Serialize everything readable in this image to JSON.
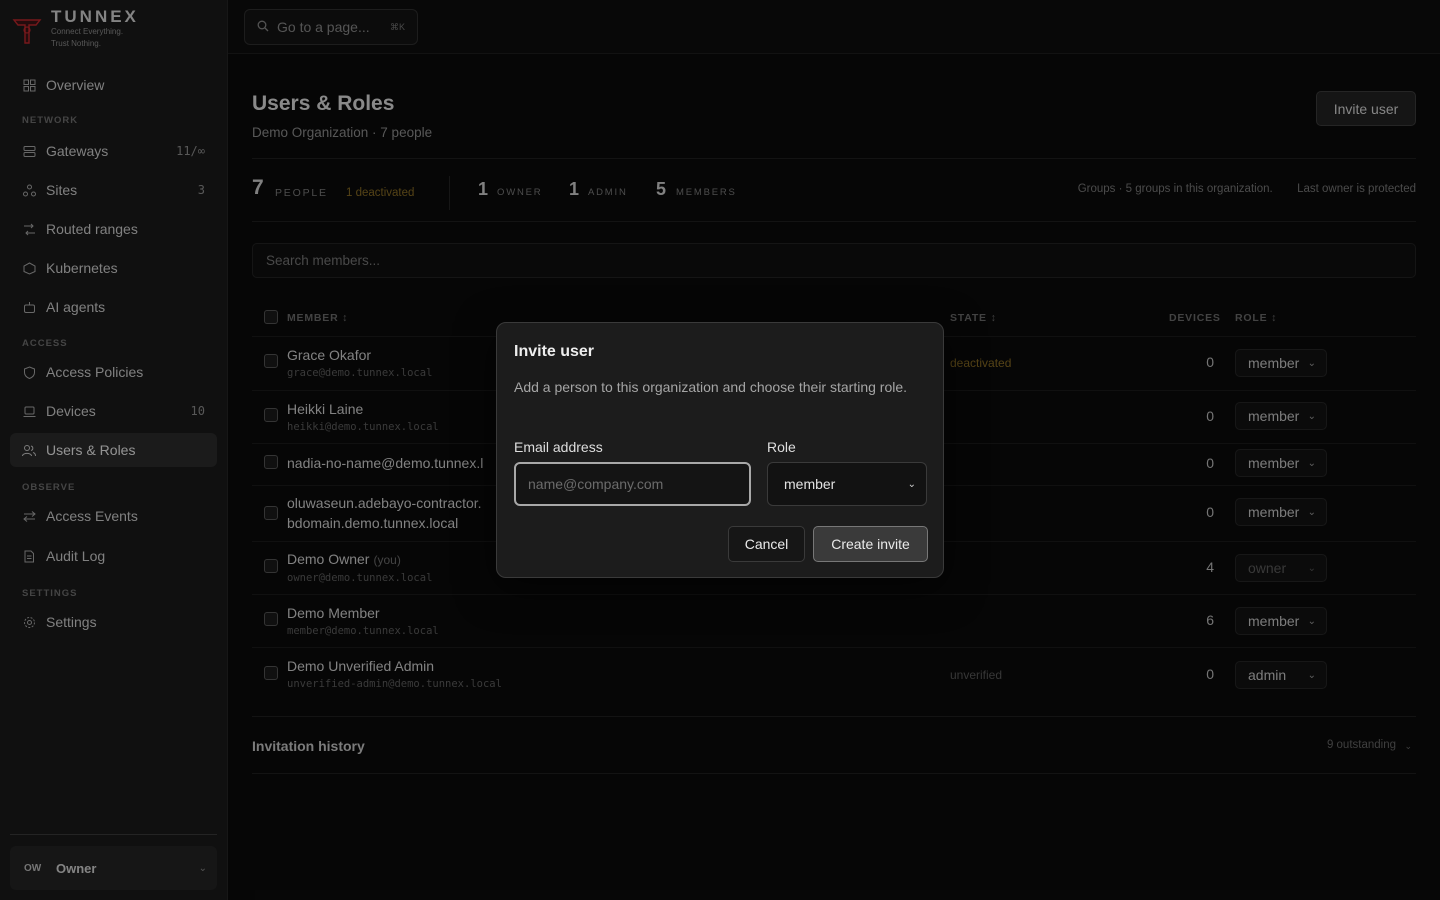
{
  "brand": {
    "name": "TUNNEX",
    "tagline_1": "Connect Everything.",
    "tagline_2": "Trust Nothing."
  },
  "sidebar": {
    "overview": "Overview",
    "section_network": "NETWORK",
    "gateways": {
      "label": "Gateways",
      "count": "11/∞"
    },
    "sites": {
      "label": "Sites",
      "count": "3"
    },
    "routed": "Routed ranges",
    "kubernetes": "Kubernetes",
    "ai_agents": "AI agents",
    "section_access": "ACCESS",
    "access_policies": "Access Policies",
    "devices": {
      "label": "Devices",
      "count": "10"
    },
    "users_roles": "Users & Roles",
    "section_observe": "OBSERVE",
    "access_events": "Access Events",
    "audit_log": "Audit Log",
    "section_settings": "SETTINGS",
    "settings": "Settings",
    "role_switch": {
      "icon_text": "OW",
      "label": "Owner"
    }
  },
  "topbar": {
    "goto_placeholder": "Go to a page...",
    "shortcut": "⌘K"
  },
  "page": {
    "title": "Users & Roles",
    "subtitle": "Demo Organization · 7 people",
    "invite_button": "Invite user"
  },
  "stats": {
    "people_count": "7",
    "people_label": "PEOPLE",
    "deactivated": "1 deactivated",
    "owner_count": "1",
    "owner_label": "OWNER",
    "admin_count": "1",
    "admin_label": "ADMIN",
    "members_count": "5",
    "members_label": "MEMBERS",
    "groups_note": "Groups · 5 groups in this organization.",
    "owner_note": "Last owner is protected"
  },
  "search": {
    "placeholder": "Search members..."
  },
  "table": {
    "headers": {
      "member": "MEMBER ↕",
      "state": "STATE ↕",
      "devices": "DEVICES",
      "role": "ROLE ↕"
    },
    "rows": [
      {
        "name": "Grace Okafor",
        "email": "grace@demo.tunnex.local",
        "state": "deactivated",
        "devices": "0",
        "role": "member"
      },
      {
        "name": "Heikki Laine",
        "email": "heikki@demo.tunnex.local",
        "state": "",
        "devices": "0",
        "role": "member"
      },
      {
        "name": "nadia-no-name@demo.tunnex.l",
        "email": "",
        "state": "",
        "devices": "0",
        "role": "member"
      },
      {
        "name": "oluwaseun.adebayo-contractor.",
        "name2": "bdomain.demo.tunnex.local",
        "state": "",
        "devices": "0",
        "role": "member"
      },
      {
        "name": "Demo Owner",
        "you": "(you)",
        "email": "owner@demo.tunnex.local",
        "state": "",
        "devices": "4",
        "role": "owner"
      },
      {
        "name": "Demo Member",
        "email": "member@demo.tunnex.local",
        "state": "",
        "devices": "6",
        "role": "member"
      },
      {
        "name": "Demo Unverified Admin",
        "email": "unverified-admin@demo.tunnex.local",
        "state": "unverified",
        "devices": "0",
        "role": "admin"
      }
    ]
  },
  "invitation_history": {
    "title": "Invitation history",
    "outstanding": "9 outstanding"
  },
  "modal": {
    "title": "Invite user",
    "description": "Add a person to this organization and choose their starting role.",
    "email_label": "Email address",
    "email_placeholder": "name@company.com",
    "email_value": "",
    "role_label": "Role",
    "role_value": "member",
    "cancel": "Cancel",
    "create": "Create invite"
  },
  "colors": {
    "accent_red": "#c0282d",
    "deactivated": "#8a6d24",
    "unverified": "#5a5a5a"
  }
}
